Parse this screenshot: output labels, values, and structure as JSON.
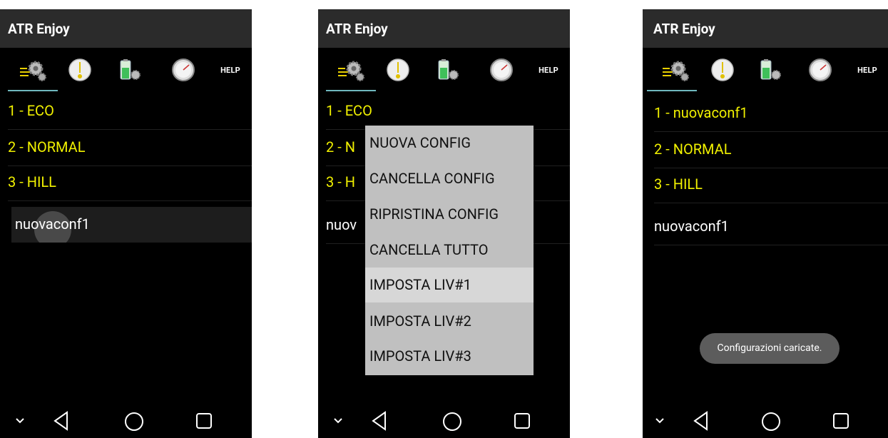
{
  "app": {
    "title": "ATR Enjoy"
  },
  "tabs": {
    "help_label": "HELP"
  },
  "phone1": {
    "rows": [
      "1 - ECO",
      "2 - NORMAL",
      "3 - HILL",
      "nuovaconf1"
    ]
  },
  "phone2": {
    "rows_visible": [
      "1 - ECO",
      "2 - N",
      "3 - H",
      "nuov"
    ],
    "menu": [
      "NUOVA CONFIG",
      "CANCELLA CONFIG",
      "RIPRISTINA CONFIG",
      "CANCELLA TUTTO",
      "IMPOSTA LIV#1",
      "IMPOSTA LIV#2",
      "IMPOSTA LIV#3"
    ]
  },
  "phone3": {
    "rows": [
      "1 - nuovaconf1",
      "2 - NORMAL",
      "3 - HILL",
      "nuovaconf1"
    ],
    "toast": "Configurazioni caricate."
  },
  "icons": [
    "settings-icon",
    "level-icon",
    "battery-settings-icon",
    "gauge-icon"
  ],
  "nav_icons": [
    "chevron-down-icon",
    "back-icon",
    "home-icon",
    "recents-icon"
  ],
  "colors": {
    "appbar": "#2b2b2b",
    "row_text_preset": "#f0f000",
    "row_text_user": "#ffffff",
    "tab_indicator": "#6fb8bf",
    "menu_bg": "#c0c0c0",
    "menu_highlight": "#d7d7d7"
  }
}
